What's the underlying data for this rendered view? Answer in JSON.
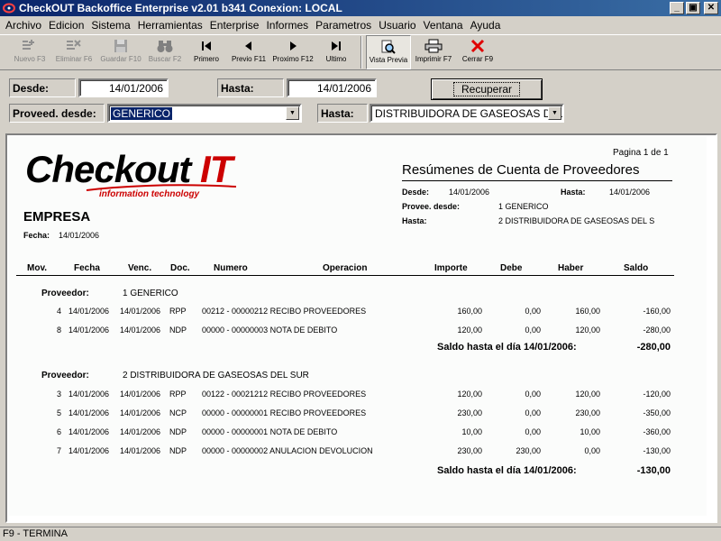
{
  "window": {
    "title": "CheckOUT Backoffice Enterprise v2.01 b341 Conexion: LOCAL",
    "minimize": "_",
    "maximize": "▣",
    "close": "✕"
  },
  "menu": [
    "Archivo",
    "Edicion",
    "Sistema",
    "Herramientas",
    "Enterprise",
    "Informes",
    "Parametros",
    "Usuario",
    "Ventana",
    "Ayuda"
  ],
  "toolbar": {
    "nuevo": "Nuevo F3",
    "eliminar": "Eliminar F6",
    "guardar": "Guardar F10",
    "buscar": "Buscar F2",
    "primero": "Primero",
    "previo": "Previo F11",
    "proximo": "Proximo F12",
    "ultimo": "Ultimo",
    "vista": "Vista Previa",
    "imprimir": "Imprimir F7",
    "cerrar": "Cerrar F9"
  },
  "filters": {
    "desde_label": "Desde:",
    "desde_value": "14/01/2006",
    "hasta_label": "Hasta:",
    "hasta_value": "14/01/2006",
    "recuperar": "Recuperar",
    "prov_desde_label": "Proveed. desde:",
    "prov_desde_value": "GENERICO",
    "prov_hasta_label": "Hasta:",
    "prov_hasta_value": "DISTRIBUIDORA DE GASEOSAS DEL S"
  },
  "report": {
    "page": "Pagina 1 de 1",
    "logo_main": "Checkout",
    "logo_it": "IT",
    "logo_tagline": "information technology",
    "company": "EMPRESA",
    "fecha_label": "Fecha:",
    "fecha_value": "14/01/2006",
    "title": "Resúmenes de Cuenta de Proveedores",
    "hdr_desde_label": "Desde:",
    "hdr_desde_value": "14/01/2006",
    "hdr_hasta_label": "Hasta:",
    "hdr_hasta_value": "14/01/2006",
    "hdr_prov_desde_label": "Provee. desde:",
    "hdr_prov_desde_value": "1 GENERICO",
    "hdr_prov_hasta_label": "Hasta:",
    "hdr_prov_hasta_value": "2 DISTRIBUIDORA DE GASEOSAS DEL S",
    "columns": {
      "mov": "Mov.",
      "fecha": "Fecha",
      "venc": "Venc.",
      "doc": "Doc.",
      "numero": "Numero",
      "operacion": "Operacion",
      "importe": "Importe",
      "debe": "Debe",
      "haber": "Haber",
      "saldo": "Saldo"
    },
    "groups": [
      {
        "label": "Proveedor:",
        "name": "1 GENERICO",
        "rows": [
          {
            "mov": "4",
            "fecha": "14/01/2006",
            "venc": "14/01/2006",
            "doc": "RPP",
            "desc": "00212 - 00000212 RECIBO PROVEEDORES",
            "importe": "160,00",
            "debe": "0,00",
            "haber": "160,00",
            "saldo": "-160,00"
          },
          {
            "mov": "8",
            "fecha": "14/01/2006",
            "venc": "14/01/2006",
            "doc": "NDP",
            "desc": "00000 - 00000003 NOTA DE DEBITO",
            "importe": "120,00",
            "debe": "0,00",
            "haber": "120,00",
            "saldo": "-280,00"
          }
        ],
        "saldo_label": "Saldo hasta el día 14/01/2006:",
        "saldo_value": "-280,00"
      },
      {
        "label": "Proveedor:",
        "name": "2 DISTRIBUIDORA DE GASEOSAS DEL SUR",
        "rows": [
          {
            "mov": "3",
            "fecha": "14/01/2006",
            "venc": "14/01/2006",
            "doc": "RPP",
            "desc": "00122 - 00021212 RECIBO PROVEEDORES",
            "importe": "120,00",
            "debe": "0,00",
            "haber": "120,00",
            "saldo": "-120,00"
          },
          {
            "mov": "5",
            "fecha": "14/01/2006",
            "venc": "14/01/2006",
            "doc": "NCP",
            "desc": "00000 - 00000001 RECIBO PROVEEDORES",
            "importe": "230,00",
            "debe": "0,00",
            "haber": "230,00",
            "saldo": "-350,00"
          },
          {
            "mov": "6",
            "fecha": "14/01/2006",
            "venc": "14/01/2006",
            "doc": "NDP",
            "desc": "00000 - 00000001 NOTA DE DEBITO",
            "importe": "10,00",
            "debe": "0,00",
            "haber": "10,00",
            "saldo": "-360,00"
          },
          {
            "mov": "7",
            "fecha": "14/01/2006",
            "venc": "14/01/2006",
            "doc": "NDP",
            "desc": "00000 - 00000002 ANULACION DEVOLUCION",
            "importe": "230,00",
            "debe": "230,00",
            "haber": "0,00",
            "saldo": "-130,00"
          }
        ],
        "saldo_label": "Saldo hasta el día 14/01/2006:",
        "saldo_value": "-130,00"
      }
    ]
  },
  "status": "F9 - TERMINA"
}
